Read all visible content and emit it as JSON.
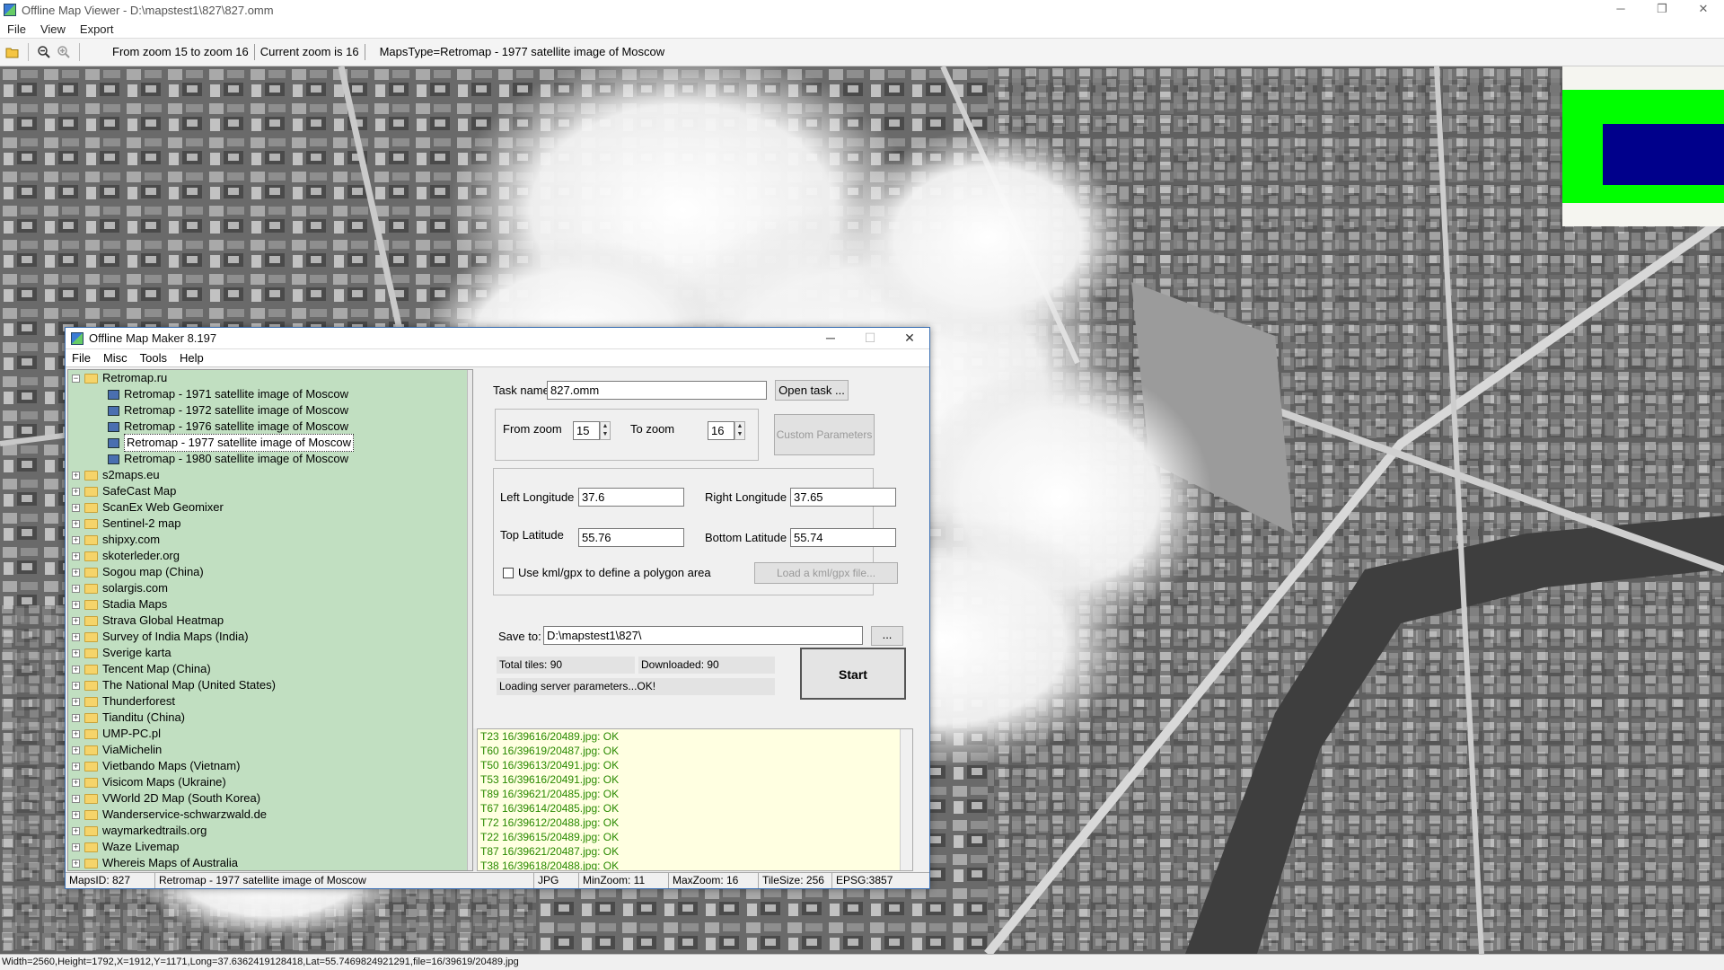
{
  "window": {
    "title": "Offline Map Viewer - D:\\mapstest1\\827\\827.omm",
    "controls": [
      "─",
      "❐",
      "✕"
    ]
  },
  "menubar": [
    "File",
    "View",
    "Export"
  ],
  "toolbar": {
    "zoom_range": "From zoom 15 to zoom 16",
    "current_zoom": "Current zoom is 16",
    "maps_type": "MapsType=Retromap - 1977 satellite image of Moscow"
  },
  "statusbar": {
    "text": "Width=2560,Height=1792,X=1912,Y=1171,Long=37.6362419128418,Lat=55.7469824921291,file=16/39619/20489.jpg"
  },
  "dialog": {
    "title": "Offline Map Maker 8.197",
    "controls": [
      "─",
      "☐",
      "✕"
    ],
    "menu": [
      "File",
      "Misc",
      "Tools",
      "Help"
    ],
    "tree": {
      "root": "Retromap.ru",
      "children": [
        "Retromap - 1971 satellite image of Moscow",
        "Retromap - 1972 satellite image of Moscow",
        "Retromap - 1976 satellite image of Moscow",
        "Retromap - 1977 satellite image of Moscow",
        "Retromap - 1980 satellite image of Moscow"
      ],
      "selected_index": 3,
      "providers": [
        "s2maps.eu",
        "SafeCast Map",
        "ScanEx Web Geomixer",
        "Sentinel-2 map",
        "shipxy.com",
        "skoterleder.org",
        "Sogou map (China)",
        "solargis.com",
        "Stadia Maps",
        "Strava Global Heatmap",
        "Survey of India Maps (India)",
        "Sverige karta",
        "Tencent Map (China)",
        "The National Map (United States)",
        "Thunderforest",
        "Tianditu (China)",
        "UMP-PC.pl",
        "ViaMichelin",
        "Vietbando Maps (Vietnam)",
        "Visicom Maps (Ukraine)",
        "VWorld 2D Map (South Korea)",
        "Wanderservice-schwarzwald.de",
        "waymarkedtrails.org",
        "Waze Livemap",
        "Whereis Maps of Australia"
      ]
    },
    "form": {
      "task_name_label": "Task name",
      "task_name_value": "827.omm",
      "open_task": "Open task ...",
      "from_zoom_label": "From zoom",
      "from_zoom_value": "15",
      "to_zoom_label": "To zoom",
      "to_zoom_value": "16",
      "custom_params": "Custom Parameters",
      "left_lon_label": "Left Longitude",
      "left_lon_value": "37.6",
      "right_lon_label": "Right Longitude",
      "right_lon_value": "37.65",
      "top_lat_label": "Top Latitude",
      "top_lat_value": "55.76",
      "bottom_lat_label": "Bottom Latitude",
      "bottom_lat_value": "55.74",
      "kml_label": "Use kml/gpx to define a polygon area",
      "load_kml": "Load a kml/gpx file...",
      "save_to_label": "Save to:",
      "save_to_value": "D:\\mapstest1\\827\\",
      "browse": "...",
      "total_tiles": "Total tiles: 90",
      "downloaded": "Downloaded: 90",
      "status": "Loading server parameters...OK!",
      "start": "Start"
    },
    "log": [
      "T23 16/39616/20489.jpg: OK",
      "T60 16/39619/20487.jpg: OK",
      "T50 16/39613/20491.jpg: OK",
      "T53 16/39616/20491.jpg: OK",
      "T89 16/39621/20485.jpg: OK",
      "T67 16/39614/20485.jpg: OK",
      "T72 16/39612/20488.jpg: OK",
      "T22 16/39615/20489.jpg: OK",
      "T87 16/39621/20487.jpg: OK",
      "T38 16/39618/20488.jpg: OK"
    ],
    "status": {
      "maps_id": "MapsID: 827",
      "maps_name": "Retromap - 1977 satellite image of Moscow",
      "format": "JPG",
      "min_zoom": "MinZoom: 11",
      "max_zoom": "MaxZoom: 16",
      "tile_size": "TileSize: 256",
      "epsg": "EPSG:3857"
    }
  },
  "colors": {
    "tree_bg": "#c1dfc1",
    "log_bg": "#ffffe1",
    "log_text": "#2a8a00",
    "minimap_green": "#00ff00",
    "minimap_view": "#00008b"
  }
}
